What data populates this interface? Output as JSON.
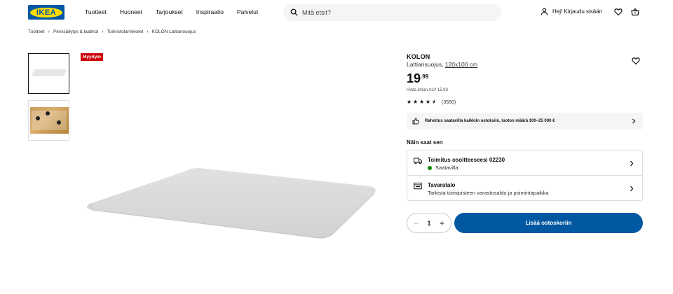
{
  "header": {
    "logo_text": "IKEA",
    "nav": [
      "Tuotteet",
      "Huoneet",
      "Tarjoukset",
      "Inspiraatio",
      "Palvelut"
    ],
    "search_placeholder": "Mitä etsit?",
    "user_label": "Hej! Kirjaudu sisään"
  },
  "breadcrumb": [
    "Tuotteet",
    "Pienisäilytys & laatikot",
    "Toimistotarvikkeet",
    "KOLON Lattiansuojus"
  ],
  "badge": "Myydyin",
  "product": {
    "name": "KOLON",
    "desc": "Lattiansuojus,",
    "size": "120x100 cm",
    "price_int": "19",
    "price_dec": ".99",
    "vat_note": "Hinta ilman ALV 15,93",
    "rating_value": 4.5,
    "reviews": "(3550)"
  },
  "finance_text": "Rahoitus saatavilla kaikkiin ostoksiin, luoton määrä 100–25 000 €",
  "how_get": "Näin saat sen",
  "delivery": {
    "title": "Toimitus osoitteeseesi 02230",
    "status": "Saatavilla"
  },
  "store": {
    "title": "Tavaratalo",
    "sub": "Tarkista toimipisteen varastosaldo ja poimintapaikka"
  },
  "quantity": "1",
  "add_to_cart": "Lisää ostoskoriin",
  "colors": {
    "brand_blue": "#0058a3",
    "brand_yellow": "#ffdb00",
    "badge_red": "#cc0008",
    "available_green": "#0a8a00"
  }
}
